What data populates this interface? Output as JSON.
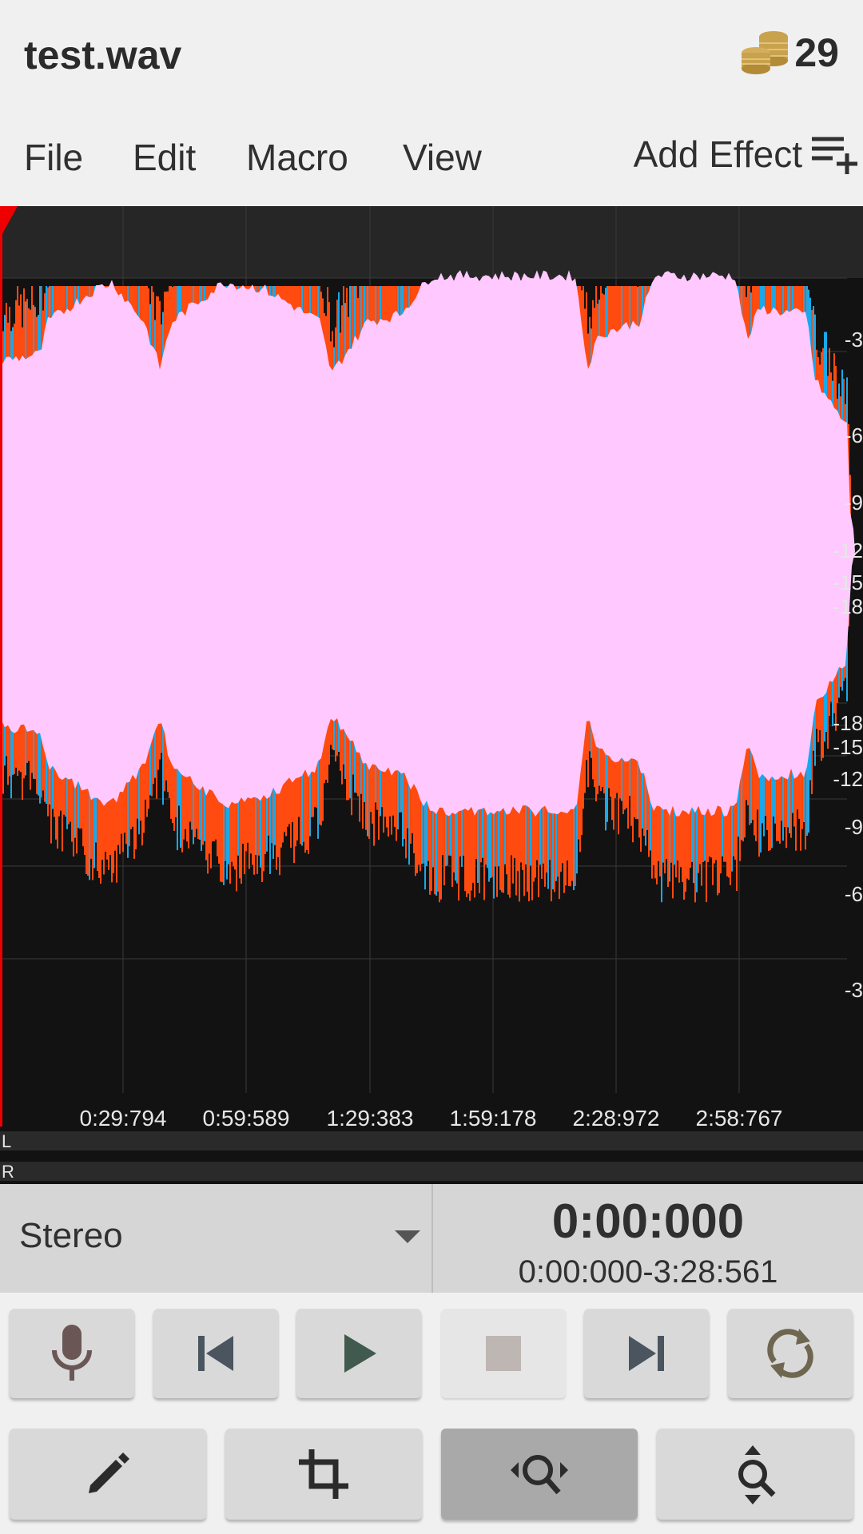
{
  "title": "test.wav",
  "coins": {
    "count": "29",
    "icon": "coins-icon"
  },
  "menu": {
    "file": "File",
    "edit": "Edit",
    "macro": "Macro",
    "view": "View",
    "add_effect": "Add Effect"
  },
  "timeline": {
    "labels": [
      "0:29:794",
      "0:59:589",
      "1:29:383",
      "1:59:178",
      "2:28:972",
      "2:58:767"
    ]
  },
  "db_scale": {
    "labels": [
      "-3",
      "-6",
      "-9",
      "-12",
      "-15",
      "-18",
      "-18",
      "-15",
      "-12",
      "-9",
      "-6",
      "-3"
    ]
  },
  "channels": {
    "left": "L",
    "right": "R"
  },
  "colors": {
    "waveform": "#ffc8ff",
    "peak_orange": "#ff4a10",
    "peak_blue": "#1aa8e8",
    "background": "#121212",
    "playhead": "#ee0000"
  },
  "info": {
    "channel_mode": "Stereo",
    "current_time": "0:00:000",
    "selection_range": "0:00:000-3:28:561"
  },
  "transport": {
    "record": "mic-icon",
    "skip_back": "skip-previous-icon",
    "play": "play-icon",
    "stop": "stop-icon",
    "skip_forward": "skip-next-icon",
    "loop": "loop-icon"
  },
  "tools": {
    "draw": "pencil-icon",
    "crop": "crop-icon",
    "zoom_horizontal": "zoom-horizontal-icon",
    "zoom_vertical": "zoom-vertical-icon"
  }
}
